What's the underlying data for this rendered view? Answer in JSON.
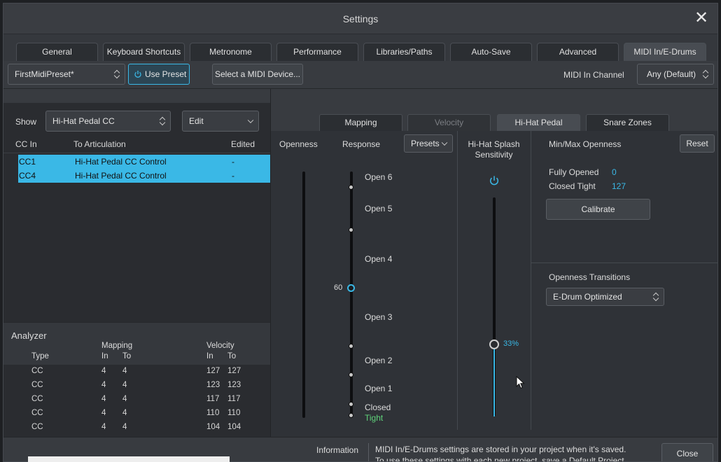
{
  "window": {
    "title": "Settings"
  },
  "tabs": [
    {
      "label": "General"
    },
    {
      "label": "Keyboard Shortcuts"
    },
    {
      "label": "Metronome"
    },
    {
      "label": "Performance"
    },
    {
      "label": "Libraries/Paths"
    },
    {
      "label": "Auto-Save"
    },
    {
      "label": "Advanced"
    },
    {
      "label": "MIDI In/E-Drums"
    }
  ],
  "toolbar": {
    "preset_value": "FirstMidiPreset*",
    "use_preset_label": "Use Preset",
    "select_device_label": "Select a MIDI Device...",
    "midi_channel_label": "MIDI In Channel",
    "midi_channel_value": "Any (Default)"
  },
  "mapping_list": {
    "show_label": "Show",
    "show_value": "Hi-Hat Pedal CC",
    "edit_label": "Edit",
    "headers": {
      "cc_in": "CC In",
      "to_articulation": "To Articulation",
      "edited": "Edited"
    },
    "rows": [
      {
        "cc": "CC1",
        "articulation": "Hi-Hat Pedal CC Control",
        "edited": "-"
      },
      {
        "cc": "CC4",
        "articulation": "Hi-Hat Pedal CC Control",
        "edited": "-"
      }
    ]
  },
  "analyzer": {
    "title": "Analyzer",
    "headers": {
      "type": "Type",
      "mapping": "Mapping",
      "velocity": "Velocity",
      "in": "In",
      "to": "To"
    },
    "rows": [
      {
        "type": "CC",
        "map_in": "4",
        "map_to": "4",
        "vel_in": "127",
        "vel_to": "127"
      },
      {
        "type": "CC",
        "map_in": "4",
        "map_to": "4",
        "vel_in": "123",
        "vel_to": "123"
      },
      {
        "type": "CC",
        "map_in": "4",
        "map_to": "4",
        "vel_in": "117",
        "vel_to": "117"
      },
      {
        "type": "CC",
        "map_in": "4",
        "map_to": "4",
        "vel_in": "110",
        "vel_to": "110"
      },
      {
        "type": "CC",
        "map_in": "4",
        "map_to": "4",
        "vel_in": "104",
        "vel_to": "104"
      }
    ]
  },
  "subtabs": [
    {
      "label": "Mapping"
    },
    {
      "label": "Velocity"
    },
    {
      "label": "Hi-Hat Pedal"
    },
    {
      "label": "Snare Zones"
    }
  ],
  "hihat": {
    "openness_label": "Openness",
    "response_label": "Response",
    "presets_label": "Presets",
    "response_value": "60",
    "response_points": [
      "Open 6",
      "Open 5",
      "Open 4",
      "Open 3",
      "Open 2",
      "Open 1",
      "Closed"
    ],
    "tight_label": "Tight",
    "splash_label_1": "Hi-Hat Splash",
    "splash_label_2": "Sensitivity",
    "splash_value": "33%",
    "splash_level": 0.33,
    "minmax_label": "Min/Max Openness",
    "reset_label": "Reset",
    "fully_opened_label": "Fully Opened",
    "fully_opened_value": "0",
    "closed_tight_label": "Closed Tight",
    "closed_tight_value": "127",
    "calibrate_label": "Calibrate",
    "transitions_label": "Openness Transitions",
    "transitions_value": "E-Drum Optimized"
  },
  "footer": {
    "info_label": "Information",
    "info_line1": "MIDI In/E-Drums settings are stored in your project when it's saved.",
    "info_line2": "To use these settings with each new project, save a Default Project.",
    "close_label": "Close"
  },
  "colors": {
    "accent": "#3ab8e6",
    "green": "#5fd27a"
  }
}
